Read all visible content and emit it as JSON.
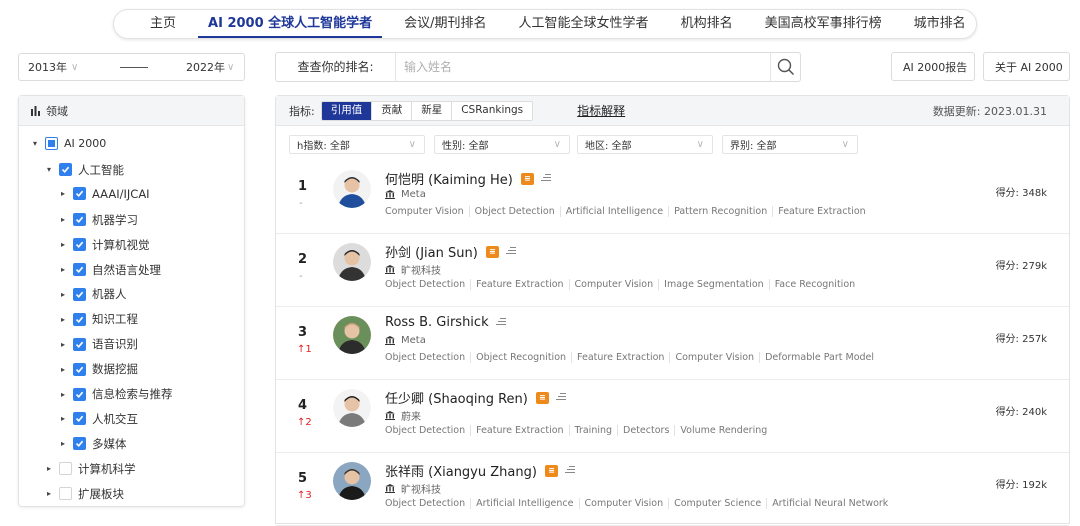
{
  "nav": {
    "tabs": [
      {
        "label": "主页",
        "active": false
      },
      {
        "label": "AI 2000 全球人工智能学者",
        "active": true
      },
      {
        "label": "会议/期刊排名",
        "active": false
      },
      {
        "label": "人工智能全球女性学者",
        "active": false
      },
      {
        "label": "机构排名",
        "active": false
      },
      {
        "label": "美国高校军事排行榜",
        "active": false
      },
      {
        "label": "城市排名",
        "active": false
      }
    ]
  },
  "year_range": {
    "start": "2013年",
    "end": "2022年"
  },
  "search": {
    "label": "查查你的排名:",
    "placeholder": "输入姓名"
  },
  "header_buttons": {
    "report": "AI 2000报告",
    "about": "关于 AI 2000"
  },
  "sidebar": {
    "title": "领域",
    "items": [
      {
        "label": "AI 2000",
        "level": 0,
        "state": "partial"
      },
      {
        "label": "人工智能",
        "level": 1,
        "state": "checked"
      },
      {
        "label": "AAAI/IJCAI",
        "level": 2,
        "state": "checked"
      },
      {
        "label": "机器学习",
        "level": 2,
        "state": "checked"
      },
      {
        "label": "计算机视觉",
        "level": 2,
        "state": "checked"
      },
      {
        "label": "自然语言处理",
        "level": 2,
        "state": "checked"
      },
      {
        "label": "机器人",
        "level": 2,
        "state": "checked"
      },
      {
        "label": "知识工程",
        "level": 2,
        "state": "checked"
      },
      {
        "label": "语音识别",
        "level": 2,
        "state": "checked"
      },
      {
        "label": "数据挖掘",
        "level": 2,
        "state": "checked"
      },
      {
        "label": "信息检索与推荐",
        "level": 2,
        "state": "checked"
      },
      {
        "label": "人机交互",
        "level": 2,
        "state": "checked"
      },
      {
        "label": "多媒体",
        "level": 2,
        "state": "checked"
      },
      {
        "label": "计算机科学",
        "level": 1,
        "state": "empty"
      },
      {
        "label": "扩展板块",
        "level": 1,
        "state": "empty"
      }
    ]
  },
  "metrics": {
    "label": "指标:",
    "tabs": [
      {
        "label": "引用值",
        "active": true
      },
      {
        "label": "贡献",
        "active": false
      },
      {
        "label": "新星",
        "active": false
      },
      {
        "label": "CSRankings",
        "active": false
      }
    ],
    "explain": "指标解释",
    "updated": "数据更新: 2023.01.31"
  },
  "filters": [
    {
      "label": "h指数: 全部"
    },
    {
      "label": "性别: 全部"
    },
    {
      "label": "地区: 全部"
    },
    {
      "label": "界别: 全部"
    }
  ],
  "rankings": [
    {
      "rank": "1",
      "change": "-",
      "change_dir": "same",
      "name": "何恺明 (Kaiming He)",
      "badge": true,
      "org": "Meta",
      "tags": [
        "Computer Vision",
        "Object Detection",
        "Artificial Intelligence",
        "Pattern Recognition",
        "Feature Extraction"
      ],
      "score": "得分: 348k"
    },
    {
      "rank": "2",
      "change": "-",
      "change_dir": "same",
      "name": "孙剑 (Jian Sun)",
      "badge": true,
      "org": "旷视科技",
      "tags": [
        "Object Detection",
        "Feature Extraction",
        "Computer Vision",
        "Image Segmentation",
        "Face Recognition"
      ],
      "score": "得分: 279k"
    },
    {
      "rank": "3",
      "change": "↑1",
      "change_dir": "up",
      "name": "Ross B. Girshick",
      "badge": false,
      "org": "Meta",
      "tags": [
        "Object Detection",
        "Object Recognition",
        "Feature Extraction",
        "Computer Vision",
        "Deformable Part Model"
      ],
      "score": "得分: 257k"
    },
    {
      "rank": "4",
      "change": "↑2",
      "change_dir": "up",
      "name": "任少卿 (Shaoqing Ren)",
      "badge": true,
      "org": "蔚来",
      "tags": [
        "Object Detection",
        "Feature Extraction",
        "Training",
        "Detectors",
        "Volume Rendering"
      ],
      "score": "得分: 240k"
    },
    {
      "rank": "5",
      "change": "↑3",
      "change_dir": "up",
      "name": "张祥雨 (Xiangyu Zhang)",
      "badge": true,
      "org": "旷视科技",
      "tags": [
        "Object Detection",
        "Artificial Intelligence",
        "Computer Vision",
        "Computer Science",
        "Artificial Neural Network"
      ],
      "score": "得分: 192k"
    }
  ],
  "icons": {
    "search": "magnifier-icon",
    "report": "document-icon",
    "about": "help-circle-icon",
    "institution": "bank-icon",
    "chart": "bar-chart-icon"
  },
  "colors": {
    "brand": "#1e3799",
    "checkbox": "#2f80ed",
    "badge": "#ee8a1c",
    "rank_up": "#e02020"
  }
}
